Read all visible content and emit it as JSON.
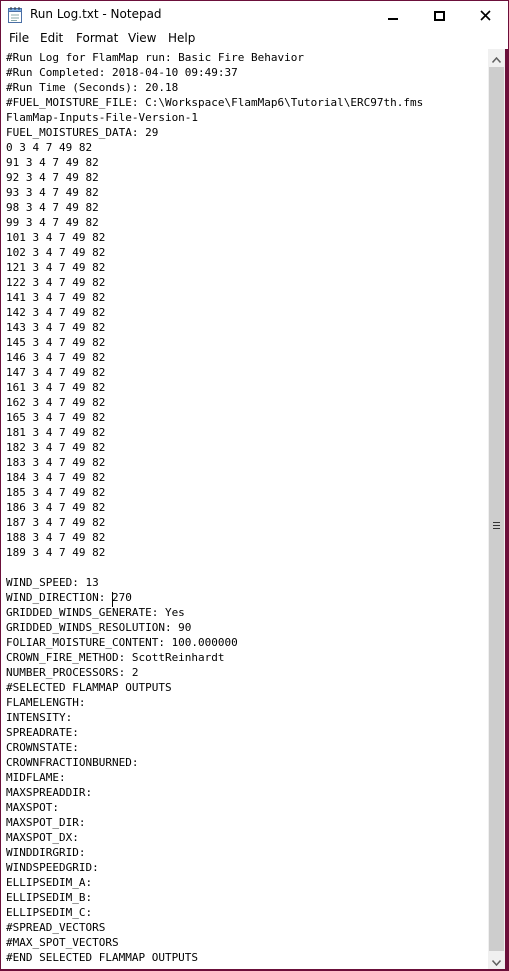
{
  "window": {
    "title": "Run Log.txt - Notepad",
    "border_color": "#6b0f3a"
  },
  "menu": [
    "File",
    "Edit",
    "Format",
    "View",
    "Help"
  ],
  "icons": {
    "app": "notepad-icon",
    "minimize": "minimize-icon",
    "maximize": "maximize-icon",
    "close": "close-icon",
    "scroll_up": "arrow-up-icon",
    "scroll_down": "arrow-down-icon"
  },
  "document": {
    "lines": [
      "#Run Log for FlamMap run: Basic Fire Behavior",
      "#Run Completed: 2018-04-10 09:49:37",
      "#Run Time (Seconds): 20.18",
      "#FUEL_MOISTURE_FILE: C:\\Workspace\\FlamMap6\\Tutorial\\ERC97th.fms",
      "FlamMap-Inputs-File-Version-1",
      "FUEL_MOISTURES_DATA: 29",
      "0 3 4 7 49 82",
      "91 3 4 7 49 82",
      "92 3 4 7 49 82",
      "93 3 4 7 49 82",
      "98 3 4 7 49 82",
      "99 3 4 7 49 82",
      "101 3 4 7 49 82",
      "102 3 4 7 49 82",
      "121 3 4 7 49 82",
      "122 3 4 7 49 82",
      "141 3 4 7 49 82",
      "142 3 4 7 49 82",
      "143 3 4 7 49 82",
      "145 3 4 7 49 82",
      "146 3 4 7 49 82",
      "147 3 4 7 49 82",
      "161 3 4 7 49 82",
      "162 3 4 7 49 82",
      "165 3 4 7 49 82",
      "181 3 4 7 49 82",
      "182 3 4 7 49 82",
      "183 3 4 7 49 82",
      "184 3 4 7 49 82",
      "185 3 4 7 49 82",
      "186 3 4 7 49 82",
      "187 3 4 7 49 82",
      "188 3 4 7 49 82",
      "189 3 4 7 49 82",
      "",
      "WIND_SPEED: 13",
      "WIND_DIRECTION: 270",
      "GRIDDED_WINDS_GENERATE: Yes",
      "GRIDDED_WINDS_RESOLUTION: 90",
      "FOLIAR_MOISTURE_CONTENT: 100.000000",
      "CROWN_FIRE_METHOD: ScottReinhardt",
      "NUMBER_PROCESSORS: 2",
      "#SELECTED FLAMMAP OUTPUTS",
      "FLAMELENGTH:",
      "INTENSITY:",
      "SPREADRATE:",
      "CROWNSTATE:",
      "CROWNFRACTIONBURNED:",
      "MIDFLAME:",
      "MAXSPREADDIR:",
      "MAXSPOT:",
      "MAXSPOT_DIR:",
      "MAXSPOT_DX:",
      "WINDDIRGRID:",
      "WINDSPEEDGRID:",
      "ELLIPSEDIM_A:",
      "ELLIPSEDIM_B:",
      "ELLIPSEDIM_C:",
      "#SPREAD_VECTORS",
      "#MAX_SPOT_VECTORS",
      "#END SELECTED FLAMMAP OUTPUTS"
    ]
  }
}
